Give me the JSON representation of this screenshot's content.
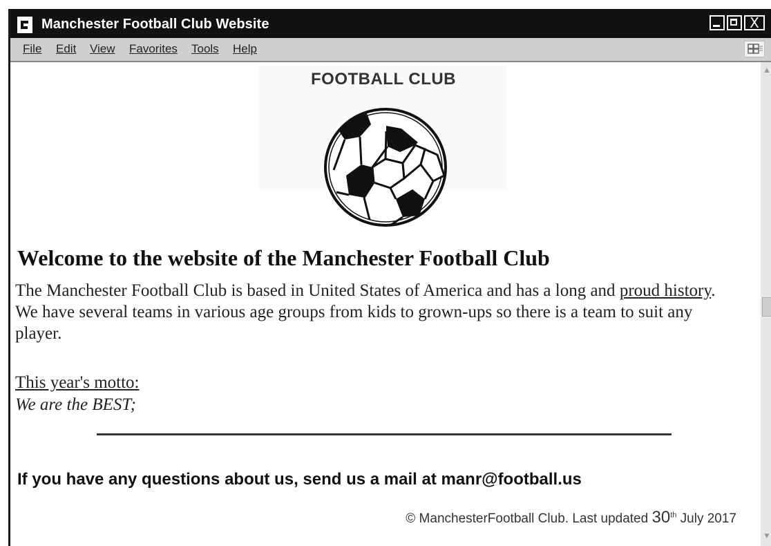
{
  "window": {
    "title": "Manchester Football Club Website",
    "controls": {
      "minimize": "_",
      "maximize": "□",
      "close": "X"
    }
  },
  "menubar": {
    "items": [
      "File",
      "Edit",
      "View",
      "Favorites",
      "Tools",
      "Help"
    ],
    "right_icon": "windows-flag-icon"
  },
  "page": {
    "logo_text": "FOOTBALL CLUB",
    "logo_icon": "football-icon",
    "heading": "Welcome to the website of the Manchester Football Club",
    "para_start": "The Manchester Football Club is based in United States of America and has a long and ",
    "para_link": "proud history",
    "para_end": ". We have several teams in various age groups from kids to grown-ups so there is a team to suit any player.",
    "motto_label": "This year's motto:",
    "motto_text": "We are the BEST;",
    "contact": "If you have any questions about us, send us a mail at manr@football.us",
    "footer_main": "© ManchesterFootball Club. Last updated ",
    "footer_day": "30",
    "footer_suffix": "th",
    "footer_end": " July 2017"
  },
  "colors": {
    "titlebar": "#111111",
    "menubar": "#cfcfcf",
    "text": "#222222"
  }
}
